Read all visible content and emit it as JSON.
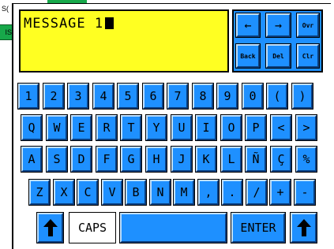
{
  "background": {
    "left_text": "S(",
    "green_button_label": "IS"
  },
  "display": {
    "text": "MESSAGE 1"
  },
  "controls": {
    "left_arrow": "←",
    "right_arrow": "→",
    "ovr": "Ovr",
    "back": "Back",
    "del": "Del",
    "clr": "Clr"
  },
  "rows": {
    "row1": [
      "1",
      "2",
      "3",
      "4",
      "5",
      "6",
      "7",
      "8",
      "9",
      "0",
      "(",
      ")"
    ],
    "row2": [
      "Q",
      "W",
      "E",
      "R",
      "T",
      "Y",
      "U",
      "I",
      "O",
      "P",
      "<",
      ">"
    ],
    "row3": [
      "A",
      "S",
      "D",
      "F",
      "G",
      "H",
      "J",
      "K",
      "L",
      "Ñ",
      "Ç",
      "%"
    ],
    "row4": [
      "Z",
      "X",
      "C",
      "V",
      "B",
      "N",
      "M",
      ",",
      ".",
      "/",
      "+",
      "-"
    ]
  },
  "bottom": {
    "caps": "CAPS",
    "space": "",
    "enter": "ENTER"
  },
  "colors": {
    "key_blue": "#1e90ff",
    "display_yellow": "#ffff22",
    "panel_bg": "#ffffff"
  },
  "icons": {
    "shift_left": "up-arrow-icon",
    "shift_right": "up-arrow-icon"
  }
}
